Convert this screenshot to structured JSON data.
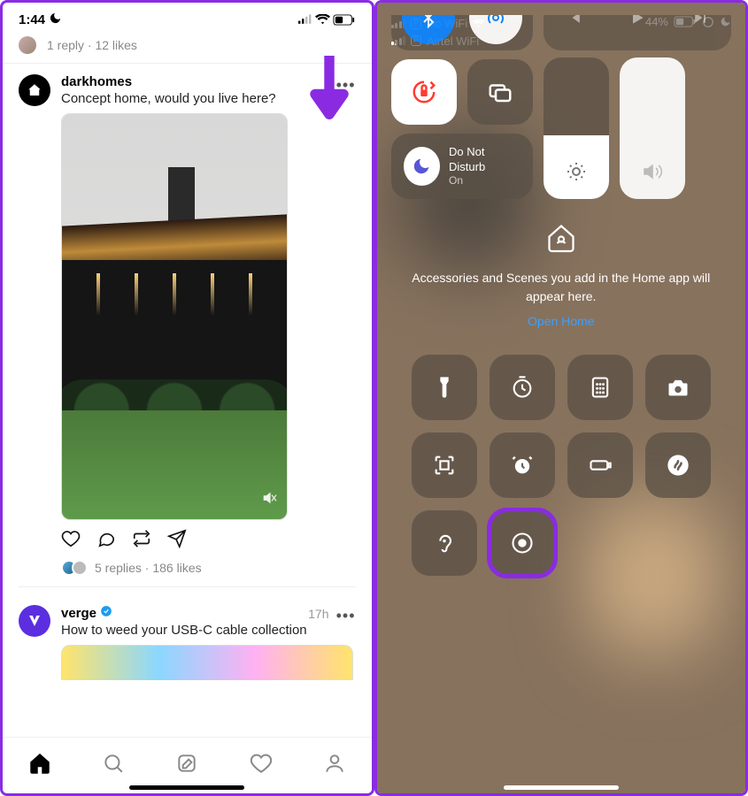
{
  "left": {
    "status": {
      "time": "1:44"
    },
    "reply_summary": "1 reply · 12 likes",
    "post1": {
      "user": "darkhomes",
      "text": "Concept home, would you live here?",
      "stats": "5 replies · 186 likes"
    },
    "post2": {
      "user": "verge",
      "time": "17h",
      "text": "How to weed your USB-C cable collection"
    }
  },
  "right": {
    "network1": "Jio WiFi",
    "network2": "Airtel WiFi",
    "battery": "44%",
    "dnd": {
      "title": "Do Not Disturb",
      "state": "On"
    },
    "home_msg": "Accessories and Scenes you add in the Home app will appear here.",
    "home_link": "Open Home"
  }
}
